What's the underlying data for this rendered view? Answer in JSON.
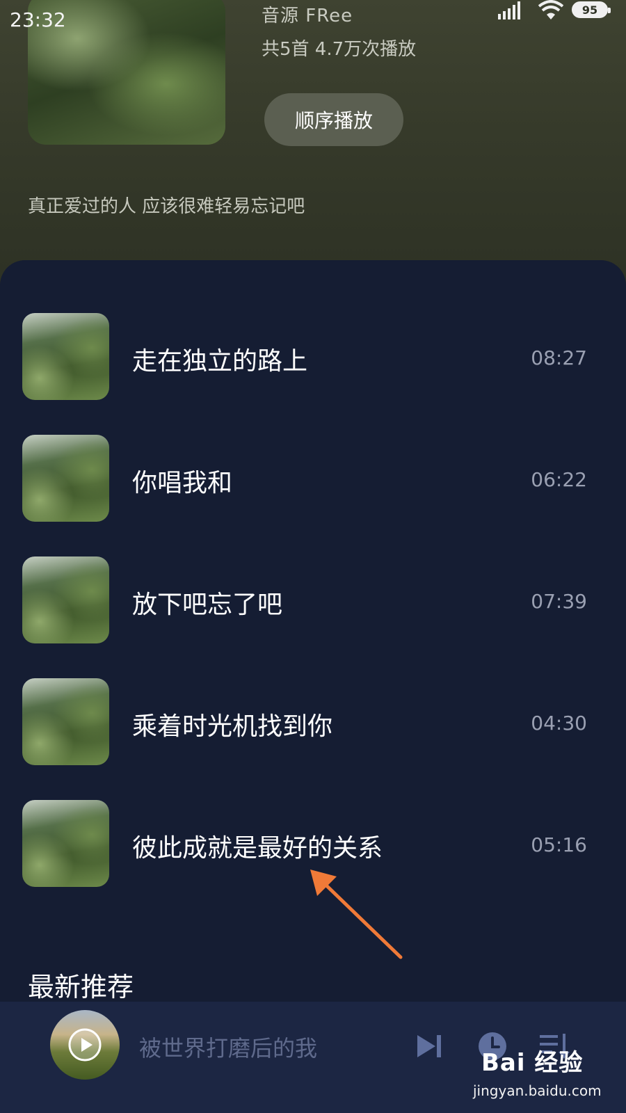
{
  "status_bar": {
    "time": "23:32",
    "battery": "95"
  },
  "playlist": {
    "source": "音源  FRee",
    "stats": "共5首  4.7万次播放",
    "play_order_label": "顺序播放",
    "description": "真正爱过的人 应该很难轻易忘记吧"
  },
  "songs": [
    {
      "title": "走在独立的路上",
      "duration": "08:27"
    },
    {
      "title": "你唱我和",
      "duration": "06:22"
    },
    {
      "title": "放下吧忘了吧",
      "duration": "07:39"
    },
    {
      "title": "乘着时光机找到你",
      "duration": "04:30"
    },
    {
      "title": "彼此成就是最好的关系",
      "duration": "05:16"
    }
  ],
  "section": {
    "title": "最新推荐"
  },
  "player": {
    "now_playing": "被世界打磨后的我"
  },
  "watermark": {
    "logo": "Bai 经验",
    "url": "jingyan.baidu.com"
  },
  "colors": {
    "header_bg": "#363a2a",
    "list_bg": "#151d33",
    "player_bg": "#1c2643",
    "annotation_arrow": "#f07a38"
  }
}
